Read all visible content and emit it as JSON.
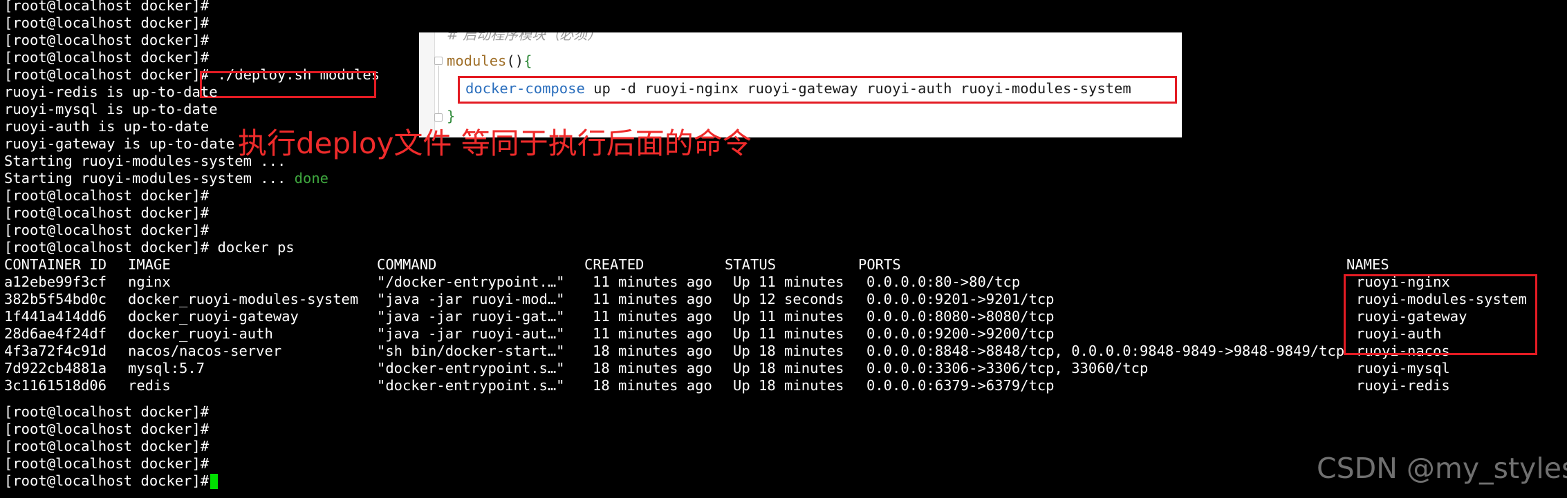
{
  "terminal": {
    "prompt_lines_top": [
      "[root@localhost docker]#",
      "[root@localhost docker]#",
      "[root@localhost docker]#",
      "[root@localhost docker]#"
    ],
    "deploy_prompt": "[root@localhost docker]# ",
    "deploy_command": "./deploy.sh modules",
    "output_lines": [
      "ruoyi-redis is up-to-date",
      "ruoyi-mysql is up-to-date",
      "ruoyi-auth is up-to-date",
      "ruoyi-gateway is up-to-date",
      "Starting ruoyi-modules-system ..."
    ],
    "starting_done_text": "Starting ruoyi-modules-system ... ",
    "done_text": "done",
    "prompt_lines_mid": [
      "[root@localhost docker]#",
      "[root@localhost docker]#",
      "[root@localhost docker]#"
    ],
    "docker_ps_line": "[root@localhost docker]# docker ps",
    "table": {
      "headers": [
        "CONTAINER ID",
        "IMAGE",
        "COMMAND",
        "CREATED",
        "STATUS",
        "PORTS",
        "NAMES"
      ],
      "rows": [
        [
          "a12ebe99f3cf",
          "nginx",
          "\"/docker-entrypoint.…\"",
          "11 minutes ago",
          "Up 11 minutes",
          "0.0.0.0:80->80/tcp",
          "ruoyi-nginx"
        ],
        [
          "382b5f54bd0c",
          "docker_ruoyi-modules-system",
          "\"java -jar ruoyi-mod…\"",
          "11 minutes ago",
          "Up 12 seconds",
          "0.0.0.0:9201->9201/tcp",
          "ruoyi-modules-system"
        ],
        [
          "1f441a414dd6",
          "docker_ruoyi-gateway",
          "\"java -jar ruoyi-gat…\"",
          "11 minutes ago",
          "Up 11 minutes",
          "0.0.0.0:8080->8080/tcp",
          "ruoyi-gateway"
        ],
        [
          "28d6ae4f24df",
          "docker_ruoyi-auth",
          "\"java -jar ruoyi-aut…\"",
          "11 minutes ago",
          "Up 11 minutes",
          "0.0.0.0:9200->9200/tcp",
          "ruoyi-auth"
        ],
        [
          "4f3a72f4c91d",
          "nacos/nacos-server",
          "\"sh bin/docker-start…\"",
          "18 minutes ago",
          "Up 18 minutes",
          "0.0.0.0:8848->8848/tcp, 0.0.0.0:9848-9849->9848-9849/tcp",
          "ruoyi-nacos"
        ],
        [
          "7d922cb4881a",
          "mysql:5.7",
          "\"docker-entrypoint.s…\"",
          "18 minutes ago",
          "Up 18 minutes",
          "0.0.0.0:3306->3306/tcp, 33060/tcp",
          "ruoyi-mysql"
        ],
        [
          "3c1161518d06",
          "redis",
          "\"docker-entrypoint.s…\"",
          "18 minutes ago",
          "Up 18 minutes",
          "0.0.0.0:6379->6379/tcp",
          "ruoyi-redis"
        ]
      ]
    },
    "prompt_lines_bottom": [
      "[root@localhost docker]#",
      "[root@localhost docker]#",
      "[root@localhost docker]#",
      "[root@localhost docker]#",
      "[root@localhost docker]# "
    ]
  },
  "editor": {
    "comment": "# 启动程序模块（必须）",
    "function_name": "modules",
    "function_parens": "()",
    "open_brace": "{",
    "command_keyword": "docker-compose",
    "command_args": " up -d ruoyi-nginx ruoyi-gateway ruoyi-auth ruoyi-modules-system",
    "close_brace": "}"
  },
  "annotation": {
    "text": "执行deploy文件 等同于执行后面的命令"
  },
  "watermark": {
    "text": "CSDN @my_styles"
  },
  "colors": {
    "background": "#000000",
    "terminal_text": "#ffffff",
    "done_green": "#3fa83f",
    "cursor_green": "#00e000",
    "highlight_red": "#e31b23",
    "annotation_red": "#ef2b2b",
    "editor_background": "#ffffff",
    "editor_keyword_blue": "#2a6ebd",
    "editor_function_brown": "#a0702a",
    "editor_brace_green": "#2f8a3a"
  }
}
